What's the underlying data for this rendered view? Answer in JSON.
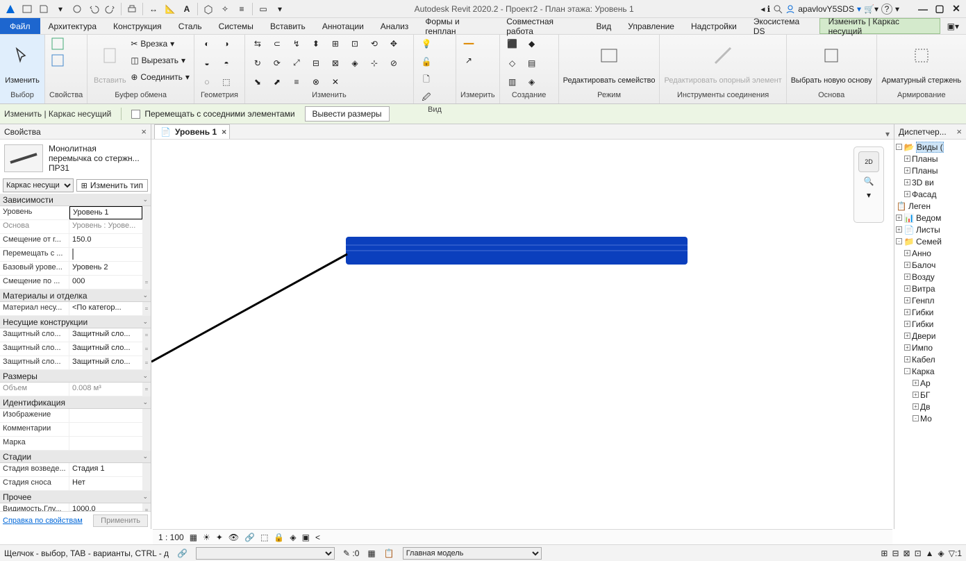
{
  "titlebar": {
    "app_title": "Autodesk Revit 2020.2 - Проект2 - План этажа: Уровень 1",
    "user": "apavlovY5SDS"
  },
  "menu": {
    "file": "Файл",
    "items": [
      "Архитектура",
      "Конструкция",
      "Сталь",
      "Системы",
      "Вставить",
      "Аннотации",
      "Анализ",
      "Формы и генплан",
      "Совместная работа",
      "Вид",
      "Управление",
      "Надстройки",
      "Экосистема DS",
      "Изменить | Каркас несущий"
    ]
  },
  "ribbon": {
    "select": {
      "label": "Выбор",
      "btn": "Изменить"
    },
    "props": {
      "label": "Свойства"
    },
    "clip": {
      "label": "Буфер обмена",
      "paste": "Вставить",
      "cut_lbl": "Вырезать",
      "copy_lbl": "Врезка",
      "join_lbl": "Соединить"
    },
    "geom": {
      "label": "Геометрия"
    },
    "modify": {
      "label": "Изменить"
    },
    "view": {
      "label": "Вид"
    },
    "measure": {
      "label": "Измерить"
    },
    "create": {
      "label": "Создание"
    },
    "mode": {
      "label": "Режим",
      "edit_family": "Редактировать семейство"
    },
    "tools": {
      "label": "Инструменты соединения",
      "edit_ref": "Редактировать опорный элемент"
    },
    "base": {
      "label": "Основа",
      "pick": "Выбрать новую основу"
    },
    "reinf": {
      "label": "Армирование",
      "bar": "Арматурный стержень"
    }
  },
  "option_bar": {
    "ctx": "Изменить | Каркас несущий",
    "chk": "Перемещать с соседними элементами",
    "btn": "Вывести размеры"
  },
  "props": {
    "title": "Свойства",
    "type_line1": "Монолитная",
    "type_line2": "перемычка со стержн...",
    "type_line3": "ПР31",
    "selector": "Каркас несущи",
    "edit_type": "Изменить тип",
    "groups": {
      "deps": "Зависимости",
      "mats": "Материалы и отделка",
      "struct": "Несущие конструкции",
      "dims": "Размеры",
      "ident": "Идентификация",
      "phases": "Стадии",
      "other": "Прочее"
    },
    "rows": {
      "level": {
        "k": "Уровень",
        "v": "Уровень 1"
      },
      "host": {
        "k": "Основа",
        "v": "Уровень : Урове..."
      },
      "offset": {
        "k": "Смещение от г...",
        "v": "150.0"
      },
      "move": {
        "k": "Перемещать с ..."
      },
      "base_lvl": {
        "k": "Базовый урове...",
        "v": "Уровень 2"
      },
      "base_off": {
        "k": "Смещение по ...",
        "v": "000"
      },
      "mat": {
        "k": "Материал несу...",
        "v": "<По категор..."
      },
      "cov1": {
        "k": "Защитный сло...",
        "v": "Защитный сло..."
      },
      "cov2": {
        "k": "Защитный сло...",
        "v": "Защитный сло..."
      },
      "cov3": {
        "k": "Защитный сло...",
        "v": "Защитный сло..."
      },
      "vol": {
        "k": "Объем",
        "v": "0.008 м³"
      },
      "img": {
        "k": "Изображение",
        "v": ""
      },
      "com": {
        "k": "Комментарии",
        "v": ""
      },
      "mark": {
        "k": "Марка",
        "v": ""
      },
      "ph1": {
        "k": "Стадия возведе...",
        "v": "Стадия 1"
      },
      "ph2": {
        "k": "Стадия сноса",
        "v": "Нет"
      },
      "vis": {
        "k": "Видимость.Глу...",
        "v": "1000.0"
      }
    },
    "help": "Справка по свойствам",
    "apply": "Применить"
  },
  "view_tabs": {
    "level1": "Уровень 1"
  },
  "browser": {
    "title": "Диспетчер...",
    "items": [
      "Виды (",
      "Планы",
      "Планы",
      "3D ви",
      "Фасад",
      "Леген",
      "Ведом",
      "Листы",
      "Семей",
      "Анно",
      "Балоч",
      "Возду",
      "Витра",
      "Генпл",
      "Гибки",
      "Гибки",
      "Двери",
      "Импо",
      "Кабел",
      "Карка",
      "Ар",
      "БГ",
      "Дв",
      "Мо"
    ]
  },
  "vc": {
    "scale": "1 : 100"
  },
  "status": {
    "hint": "Щелчок - выбор, TAB - варианты, CTRL - д",
    "zero": ":0",
    "mainmodel": "Главная модель",
    "warn": ":1"
  }
}
